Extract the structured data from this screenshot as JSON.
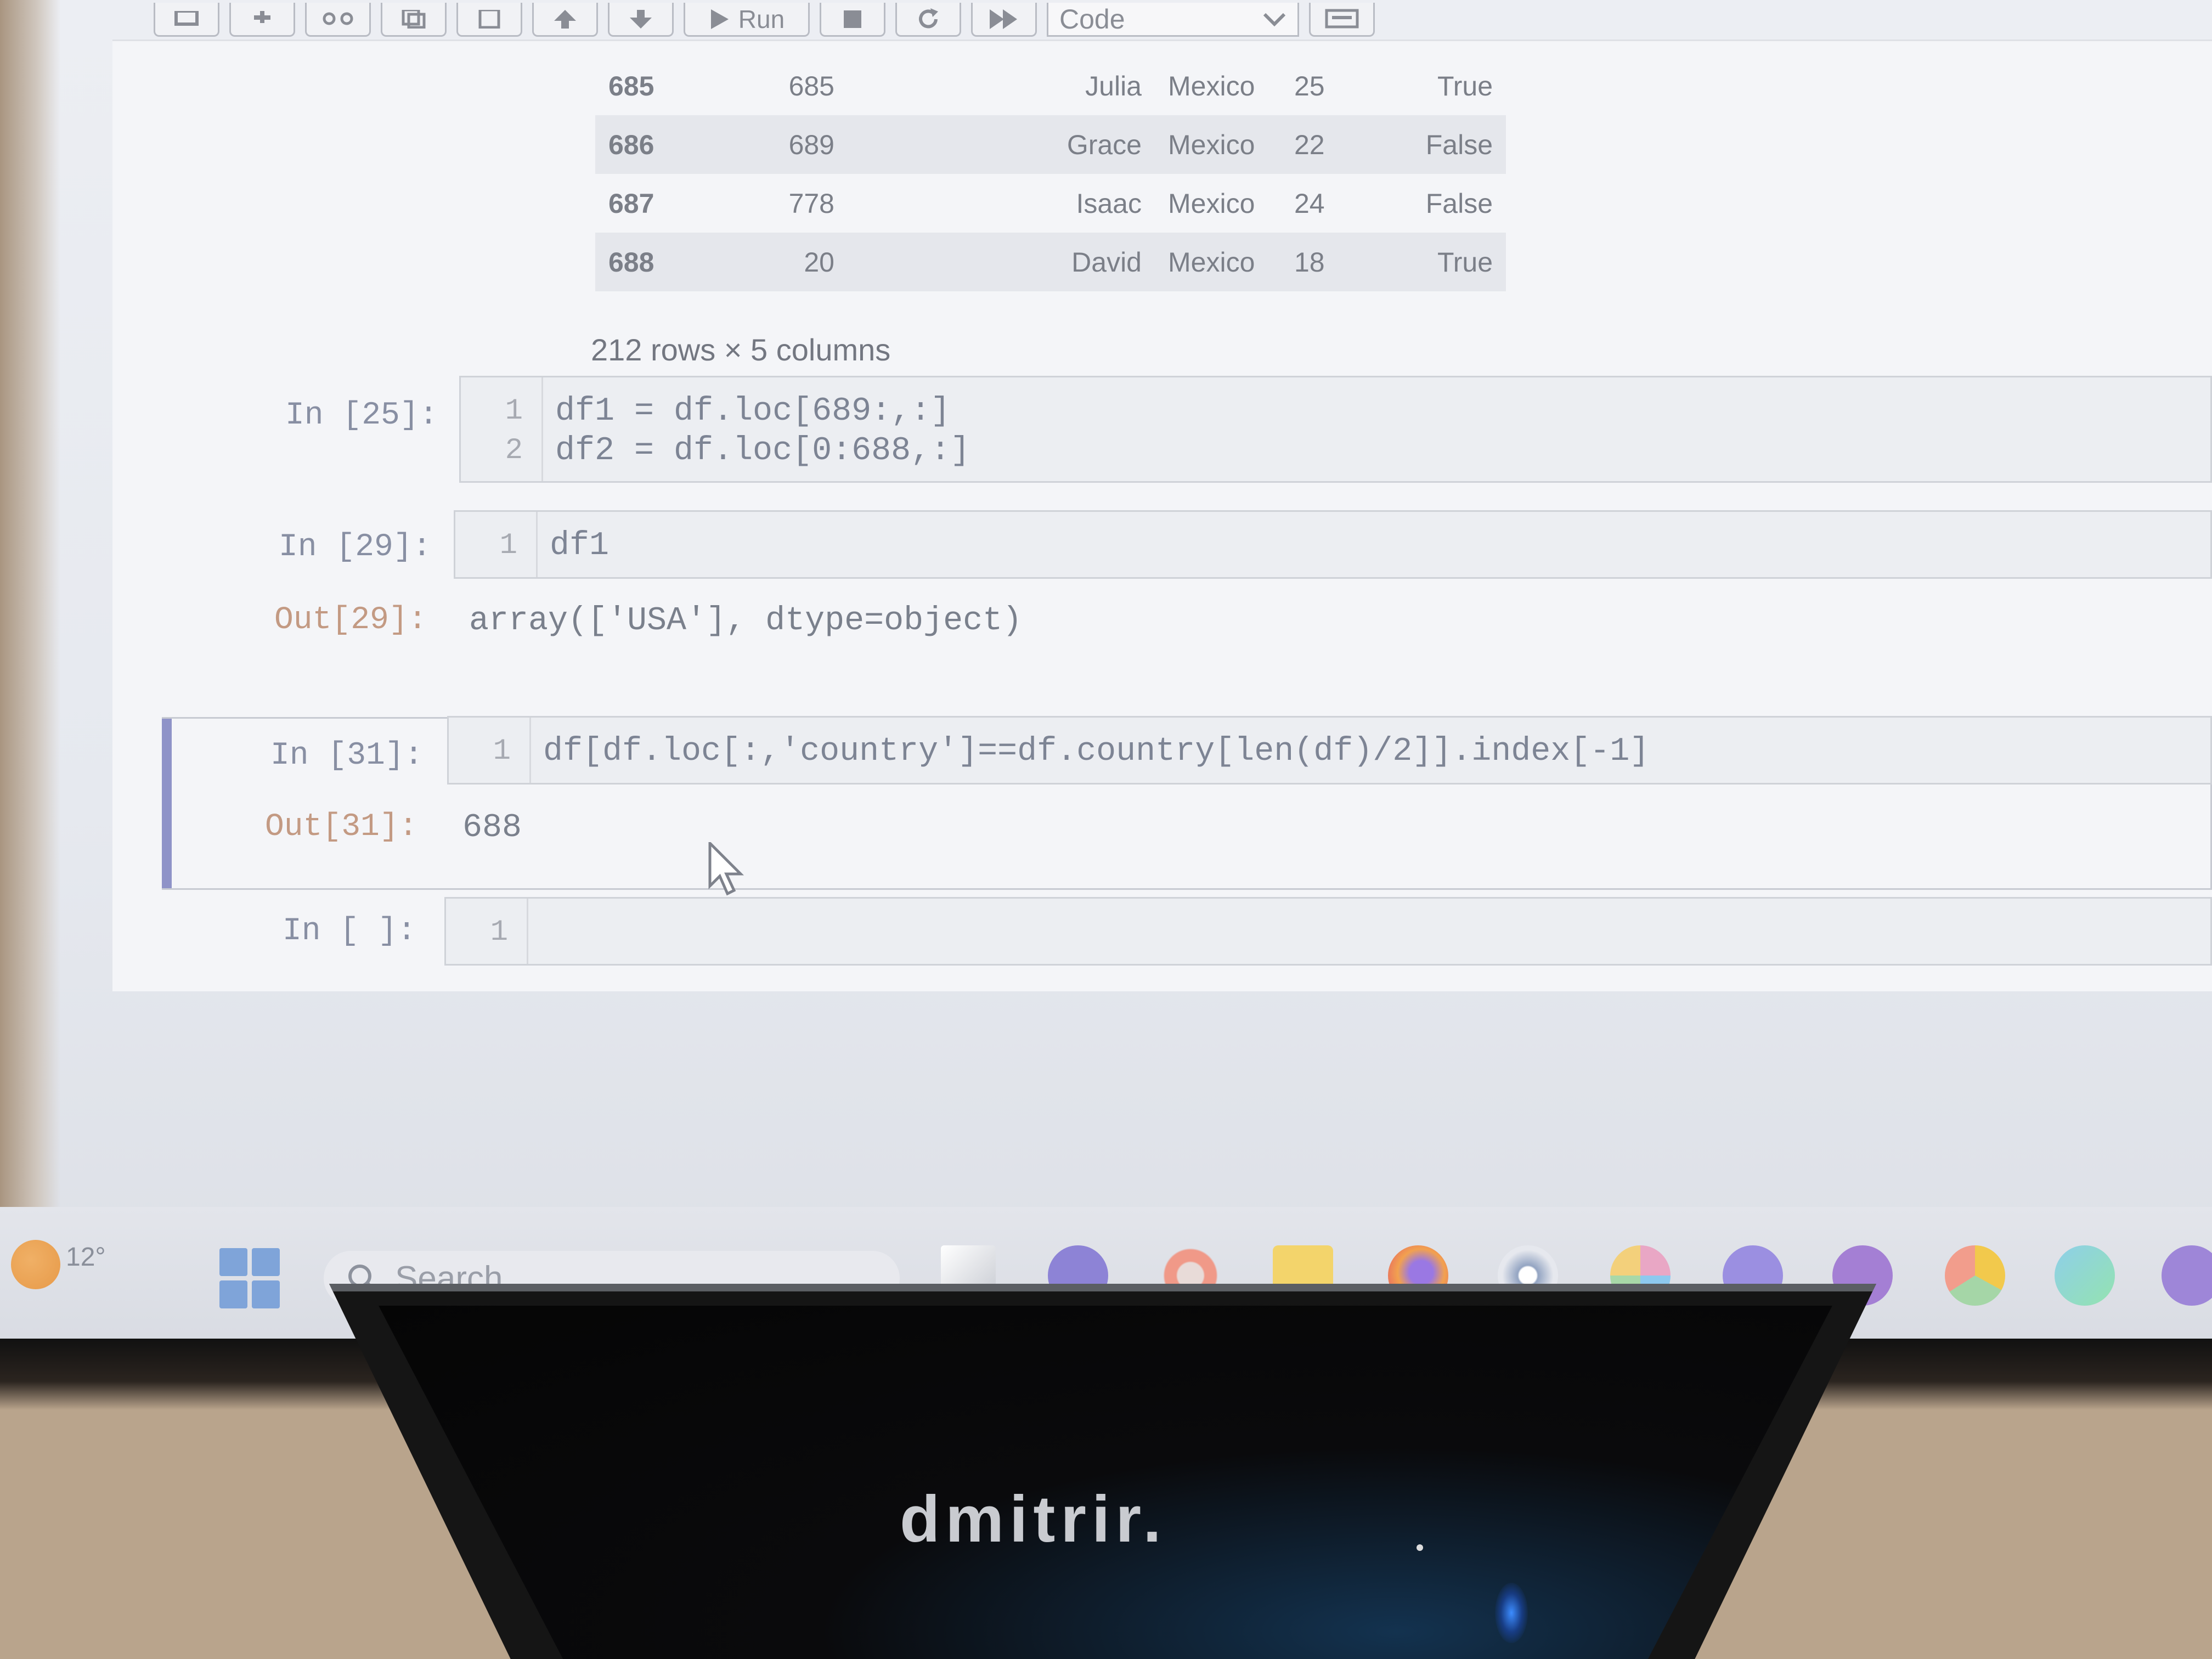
{
  "toolbar": {
    "run_label": "Run",
    "cell_type": "Code"
  },
  "table": {
    "rows": [
      {
        "index": "685",
        "id": "685",
        "name": "Julia",
        "country": "Mexico",
        "age": "25",
        "flag": "True"
      },
      {
        "index": "686",
        "id": "689",
        "name": "Grace",
        "country": "Mexico",
        "age": "22",
        "flag": "False"
      },
      {
        "index": "687",
        "id": "778",
        "name": "Isaac",
        "country": "Mexico",
        "age": "24",
        "flag": "False"
      },
      {
        "index": "688",
        "id": "20",
        "name": "David",
        "country": "Mexico",
        "age": "18",
        "flag": "True"
      }
    ],
    "summary": "212 rows × 5 columns"
  },
  "cells": [
    {
      "prompt": "In [25]:",
      "lines": [
        "1",
        "2"
      ],
      "code": [
        "df1 = df.loc[689:,:]",
        "df2 = df.loc[0:688,:]"
      ]
    },
    {
      "prompt": "In [29]:",
      "lines": [
        "1"
      ],
      "code": [
        "df1"
      ],
      "out_prompt": "Out[29]:",
      "output": "array(['USA'], dtype=object)"
    },
    {
      "prompt": "In [31]:",
      "lines": [
        "1"
      ],
      "code": [
        "df[df.loc[:,'country']==df.country[len(df)/2]].index[-1]"
      ],
      "out_prompt": "Out[31]:",
      "output": "688"
    },
    {
      "prompt": "In [ ]:",
      "lines": [
        "1"
      ],
      "code": [
        ""
      ]
    }
  ],
  "taskbar": {
    "temperature": "12°",
    "search_label": "Search"
  },
  "laptop": {
    "brand": "dmitrir."
  },
  "icons": [
    "save-icon",
    "add-icon",
    "cut-icon",
    "copy-icon",
    "paste-icon",
    "move-up-icon",
    "move-down-icon",
    "run-icon",
    "stop-icon",
    "restart-icon",
    "fast-forward-icon",
    "keyboard-icon",
    "chevron-down-icon",
    "mouse-pointer-icon",
    "weather-icon",
    "windows-start-icon",
    "search-icon",
    "task-view-icon",
    "meet-icon",
    "opera-icon",
    "file-explorer-icon",
    "firefox-icon",
    "steam-icon",
    "slack-icon",
    "discord-icon",
    "github-icon",
    "chrome-icon",
    "edge-icon",
    "infinity-icon"
  ]
}
